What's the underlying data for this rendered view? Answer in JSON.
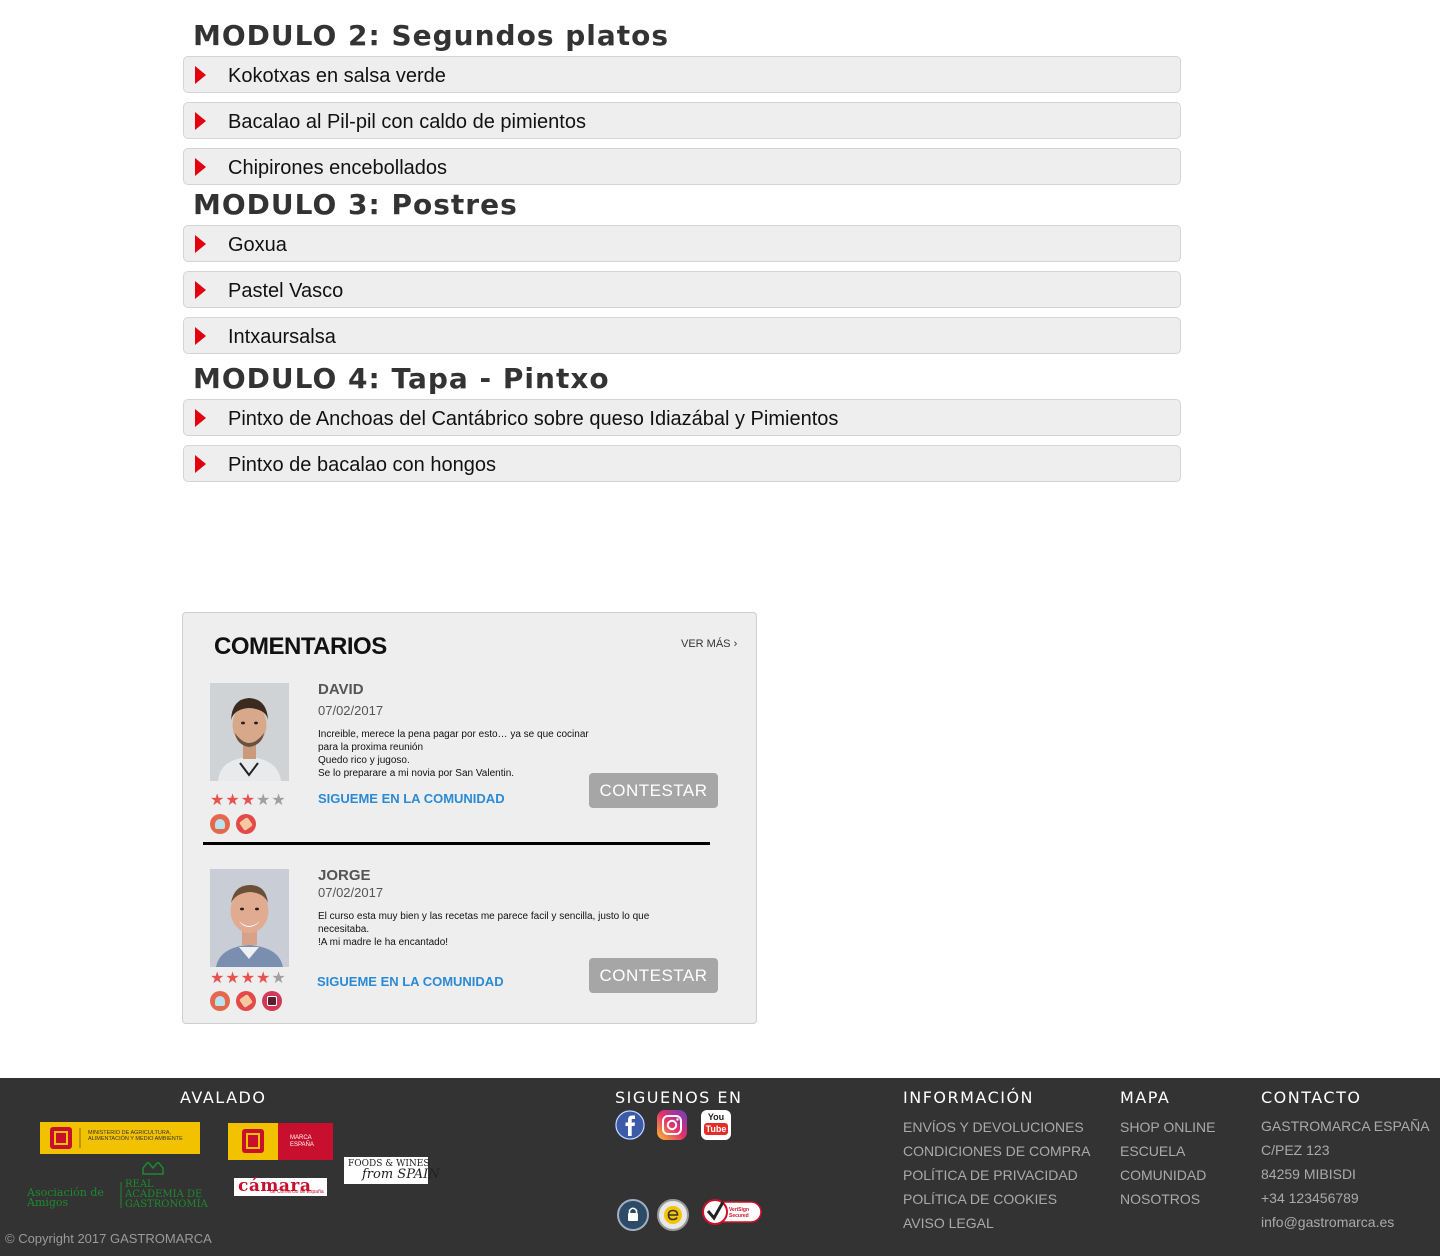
{
  "modules": [
    {
      "title": "MODULO 2: Segundos platos",
      "items": [
        "Kokotxas en salsa verde",
        "Bacalao al Pil-pil con caldo de pimientos",
        "Chipirones encebollados"
      ]
    },
    {
      "title": "MODULO 3: Postres",
      "items": [
        "Goxua",
        "Pastel Vasco",
        "Intxaursalsa"
      ]
    },
    {
      "title": "MODULO 4: Tapa - Pintxo",
      "items": [
        "Pintxo de Anchoas del Cantábrico sobre queso Idiazábal y Pimientos",
        "Pintxo de bacalao con hongos"
      ]
    }
  ],
  "comments": {
    "title": "COMENTARIOS",
    "more_label": "VER MÁS",
    "more_icon": "chevron-right-icon",
    "follow_label": "SIGUEME EN LA COMUNIDAD",
    "reply_label": "CONTESTAR",
    "entries": [
      {
        "name": "DAVID",
        "date": "07/02/2017",
        "text": "Increible, merece la pena pagar por esto… ya se que cocinar\npara la proxima reunión\nQuedo rico y jugoso.\nSe lo preparare a mi novia por San Valentin.",
        "rating": 3,
        "max_rating": 5
      },
      {
        "name": "JORGE",
        "date": "07/02/2017",
        "text": " El curso esta muy bien y las recetas me parece facil y sencilla, justo lo que necesitaba.\n!A mi madre le ha encantado!",
        "rating": 4,
        "max_rating": 5
      }
    ]
  },
  "footer": {
    "avalado": "AVALADO",
    "logos": {
      "ministerio": "MINISTERIO DE AGRICULTURA, ALIMENTACIÓN Y MEDIO AMBIENTE",
      "marca_espana": "MARCA ESPAÑA",
      "academia_left": "Asociación de Amigos",
      "academia_right": "REAL ACADEMIA DE GASTRONOMÍA",
      "camara": "cámara",
      "camara_sub": "de Comercio de España",
      "foods_wines": "FOODS & WINES",
      "from_spain": "from SPAIN"
    },
    "siguenos": "SIGUENOS EN",
    "social_icons": [
      "facebook-icon",
      "instagram-icon",
      "youtube-icon"
    ],
    "youtube_you": "You",
    "youtube_tube": "Tube",
    "verisign": "VeriSign Secured",
    "informacion": {
      "title": "INFORMACIÓN",
      "items": [
        "ENVÍOS Y DEVOLUCIONES",
        "CONDICIONES DE COMPRA",
        "POLÍTICA DE PRIVACIDAD",
        "POLÍTICA DE COOKIES",
        "AVISO LEGAL"
      ]
    },
    "mapa": {
      "title": "MAPA",
      "items": [
        "SHOP ONLINE",
        "ESCUELA",
        "COMUNIDAD",
        "NOSOTROS"
      ]
    },
    "contacto": {
      "title": "CONTACTO",
      "items": [
        "GASTROMARCA ESPAÑA",
        "C/PEZ 123",
        "84259 MIBISDI",
        "+34 123456789",
        "info@gastromarca.es"
      ]
    },
    "copyright": "© Copyright 2017 GASTROMARCA"
  },
  "colors": {
    "accent": "#e3000f",
    "link": "#2a8ad4",
    "footer_bg": "#333333",
    "star": "#e7514f"
  }
}
